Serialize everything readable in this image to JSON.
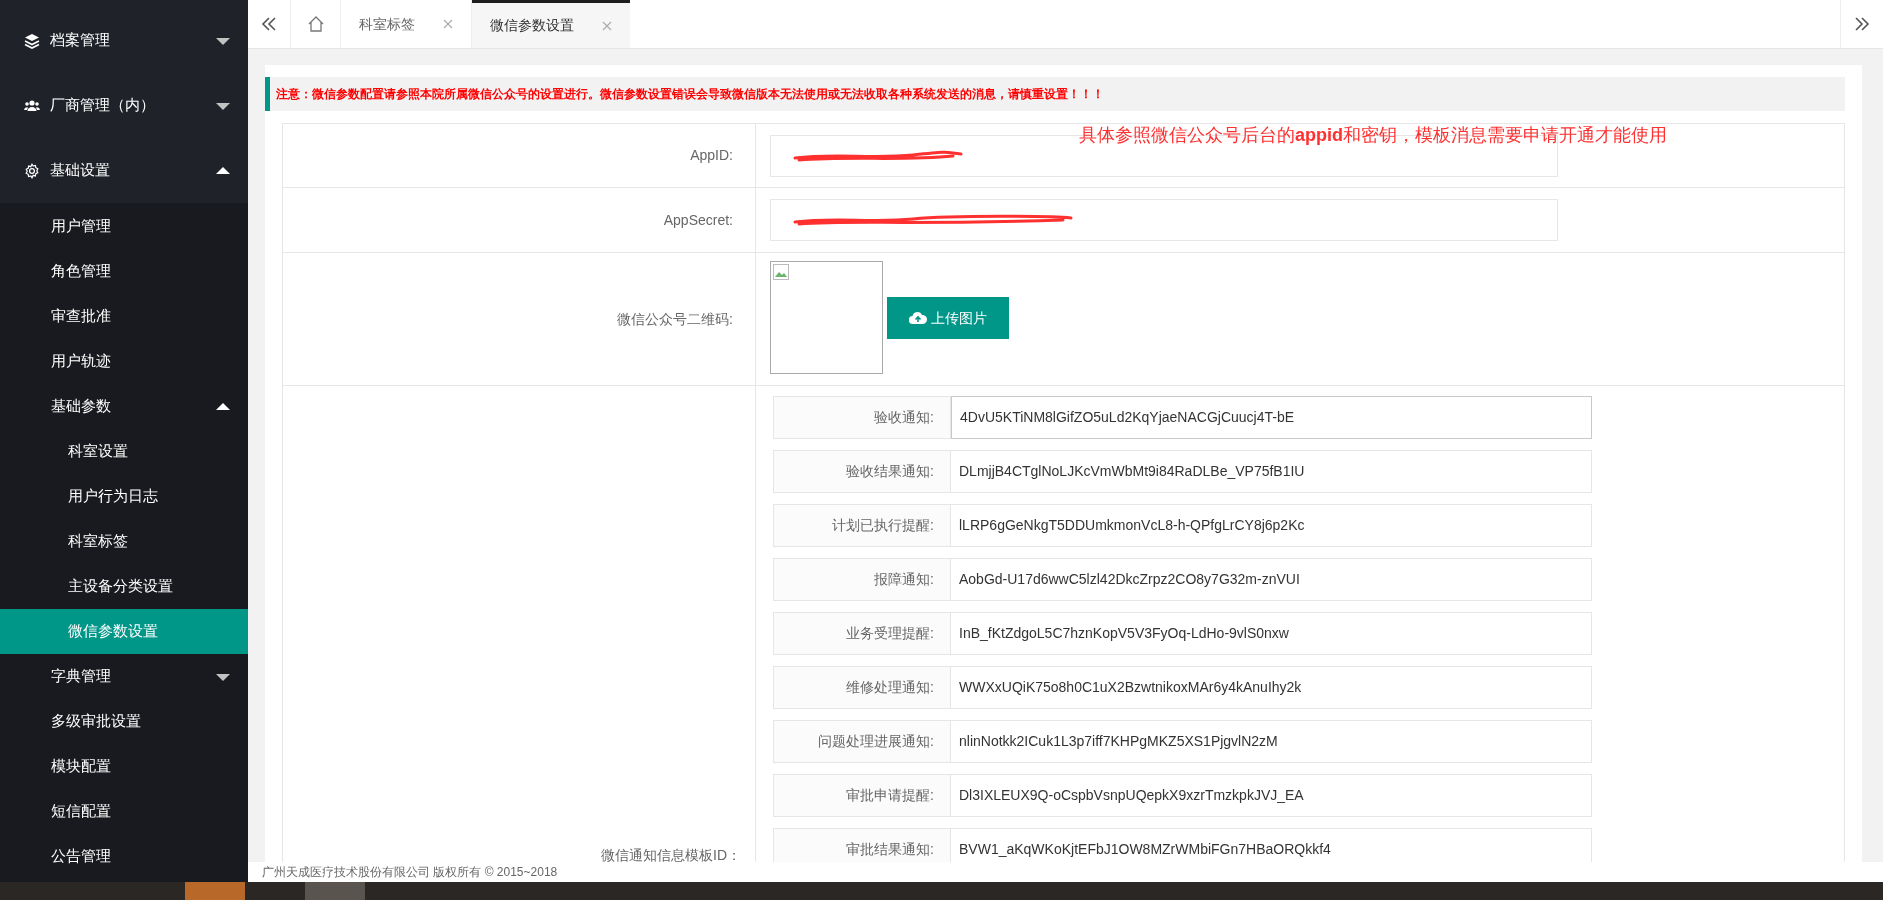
{
  "sidebar": {
    "items": [
      {
        "label": "档案管理",
        "kind": "layers",
        "expanded": false
      },
      {
        "label": "厂商管理（内）",
        "kind": "users",
        "expanded": false
      },
      {
        "label": "基础设置",
        "kind": "gear",
        "expanded": true,
        "children": [
          {
            "label": "用户管理",
            "selected": false
          },
          {
            "label": "角色管理",
            "selected": false
          },
          {
            "label": "审查批准",
            "selected": false
          },
          {
            "label": "用户轨迹",
            "selected": false
          },
          {
            "label": "基础参数",
            "selected": false,
            "expanded": true,
            "children": [
              {
                "label": "科室设置",
                "selected": false
              },
              {
                "label": "用户行为日志",
                "selected": false
              },
              {
                "label": "科室标签",
                "selected": false
              },
              {
                "label": "主设备分类设置",
                "selected": false
              },
              {
                "label": "微信参数设置",
                "selected": true
              }
            ]
          },
          {
            "label": "字典管理",
            "selected": false,
            "expanded": false
          },
          {
            "label": "多级审批设置",
            "selected": false
          },
          {
            "label": "模块配置",
            "selected": false
          },
          {
            "label": "短信配置",
            "selected": false
          },
          {
            "label": "公告管理",
            "selected": false
          }
        ]
      }
    ]
  },
  "tabs": [
    {
      "label": "科室标签",
      "selected": false
    },
    {
      "label": "微信参数设置",
      "selected": true
    }
  ],
  "notice": "注意：微信参数配置请参照本院所属微信公众号的设置进行。微信参数设置错误会导致微信版本无法使用或无法收取各种系统发送的消息，请慎重设置！！！",
  "form": {
    "appid_label": "AppID:",
    "appid_hint": "具体参照微信公众号后台的**appid**和密钥，模板消息需要申请开通才能使用",
    "appsecret_label": "AppSecret:",
    "qr_label": "微信公众号二维码:",
    "upload_button": "上传图片",
    "templates_label": "微信通知信息模板ID：",
    "templates": [
      {
        "label": "验收通知:",
        "value": "4DvU5KTiNM8lGifZO5uLd2KqYjaeNACGjCuucj4T-bE",
        "focused": true
      },
      {
        "label": "验收结果通知:",
        "value": "DLmjjB4CTglNoLJKcVmWbMt9i84RaDLBe_VP75fB1IU",
        "focused": false
      },
      {
        "label": "计划已执行提醒:",
        "value": "lLRP6gGeNkgT5DDUmkmonVcL8-h-QPfgLrCY8j6p2Kc",
        "focused": false
      },
      {
        "label": "报障通知:",
        "value": "AobGd-U17d6wwC5lzl42DkcZrpz2CO8y7G32m-znVUI",
        "focused": false
      },
      {
        "label": "业务受理提醒:",
        "value": "InB_fKtZdgoL5C7hznKopV5V3FyOq-LdHo-9vlS0nxw",
        "focused": false
      },
      {
        "label": "维修处理通知:",
        "value": "WWXxUQiK75o8h0C1uX2BzwtnikoxMAr6y4kAnuIhy2k",
        "focused": false
      },
      {
        "label": "问题处理进展通知:",
        "value": "nlinNotkk2ICuk1L3p7iff7KHPgMKZ5XS1PjgvlN2zM",
        "focused": false
      },
      {
        "label": "审批申请提醒:",
        "value": "Dl3IXLEUX9Q-oCspbVsnpUQepkX9xzrTmzkpkJVJ_EA",
        "focused": false
      },
      {
        "label": "审批结果通知:",
        "value": "BVW1_aKqWKoKjtEFbJ1OW8MZrWMbiFGn7HBaORQkkf4",
        "focused": false
      }
    ]
  },
  "footer": "广州天成医疗技术股份有限公司 版权所有 © 2015~2018"
}
